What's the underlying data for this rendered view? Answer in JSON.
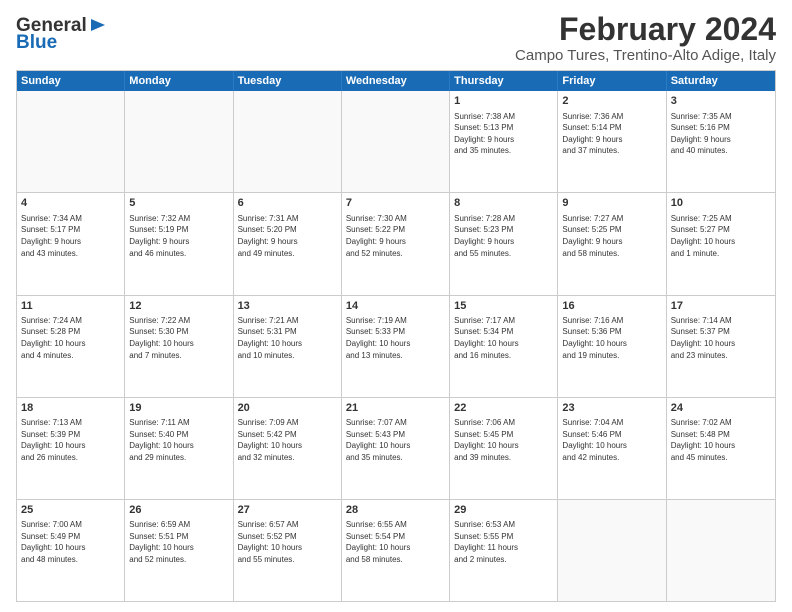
{
  "logo": {
    "line1": "General",
    "line2": "Blue",
    "arrow": true
  },
  "title": "February 2024",
  "subtitle": "Campo Tures, Trentino-Alto Adige, Italy",
  "days": [
    "Sunday",
    "Monday",
    "Tuesday",
    "Wednesday",
    "Thursday",
    "Friday",
    "Saturday"
  ],
  "weeks": [
    [
      {
        "day": "",
        "info": ""
      },
      {
        "day": "",
        "info": ""
      },
      {
        "day": "",
        "info": ""
      },
      {
        "day": "",
        "info": ""
      },
      {
        "day": "1",
        "info": "Sunrise: 7:38 AM\nSunset: 5:13 PM\nDaylight: 9 hours\nand 35 minutes."
      },
      {
        "day": "2",
        "info": "Sunrise: 7:36 AM\nSunset: 5:14 PM\nDaylight: 9 hours\nand 37 minutes."
      },
      {
        "day": "3",
        "info": "Sunrise: 7:35 AM\nSunset: 5:16 PM\nDaylight: 9 hours\nand 40 minutes."
      }
    ],
    [
      {
        "day": "4",
        "info": "Sunrise: 7:34 AM\nSunset: 5:17 PM\nDaylight: 9 hours\nand 43 minutes."
      },
      {
        "day": "5",
        "info": "Sunrise: 7:32 AM\nSunset: 5:19 PM\nDaylight: 9 hours\nand 46 minutes."
      },
      {
        "day": "6",
        "info": "Sunrise: 7:31 AM\nSunset: 5:20 PM\nDaylight: 9 hours\nand 49 minutes."
      },
      {
        "day": "7",
        "info": "Sunrise: 7:30 AM\nSunset: 5:22 PM\nDaylight: 9 hours\nand 52 minutes."
      },
      {
        "day": "8",
        "info": "Sunrise: 7:28 AM\nSunset: 5:23 PM\nDaylight: 9 hours\nand 55 minutes."
      },
      {
        "day": "9",
        "info": "Sunrise: 7:27 AM\nSunset: 5:25 PM\nDaylight: 9 hours\nand 58 minutes."
      },
      {
        "day": "10",
        "info": "Sunrise: 7:25 AM\nSunset: 5:27 PM\nDaylight: 10 hours\nand 1 minute."
      }
    ],
    [
      {
        "day": "11",
        "info": "Sunrise: 7:24 AM\nSunset: 5:28 PM\nDaylight: 10 hours\nand 4 minutes."
      },
      {
        "day": "12",
        "info": "Sunrise: 7:22 AM\nSunset: 5:30 PM\nDaylight: 10 hours\nand 7 minutes."
      },
      {
        "day": "13",
        "info": "Sunrise: 7:21 AM\nSunset: 5:31 PM\nDaylight: 10 hours\nand 10 minutes."
      },
      {
        "day": "14",
        "info": "Sunrise: 7:19 AM\nSunset: 5:33 PM\nDaylight: 10 hours\nand 13 minutes."
      },
      {
        "day": "15",
        "info": "Sunrise: 7:17 AM\nSunset: 5:34 PM\nDaylight: 10 hours\nand 16 minutes."
      },
      {
        "day": "16",
        "info": "Sunrise: 7:16 AM\nSunset: 5:36 PM\nDaylight: 10 hours\nand 19 minutes."
      },
      {
        "day": "17",
        "info": "Sunrise: 7:14 AM\nSunset: 5:37 PM\nDaylight: 10 hours\nand 23 minutes."
      }
    ],
    [
      {
        "day": "18",
        "info": "Sunrise: 7:13 AM\nSunset: 5:39 PM\nDaylight: 10 hours\nand 26 minutes."
      },
      {
        "day": "19",
        "info": "Sunrise: 7:11 AM\nSunset: 5:40 PM\nDaylight: 10 hours\nand 29 minutes."
      },
      {
        "day": "20",
        "info": "Sunrise: 7:09 AM\nSunset: 5:42 PM\nDaylight: 10 hours\nand 32 minutes."
      },
      {
        "day": "21",
        "info": "Sunrise: 7:07 AM\nSunset: 5:43 PM\nDaylight: 10 hours\nand 35 minutes."
      },
      {
        "day": "22",
        "info": "Sunrise: 7:06 AM\nSunset: 5:45 PM\nDaylight: 10 hours\nand 39 minutes."
      },
      {
        "day": "23",
        "info": "Sunrise: 7:04 AM\nSunset: 5:46 PM\nDaylight: 10 hours\nand 42 minutes."
      },
      {
        "day": "24",
        "info": "Sunrise: 7:02 AM\nSunset: 5:48 PM\nDaylight: 10 hours\nand 45 minutes."
      }
    ],
    [
      {
        "day": "25",
        "info": "Sunrise: 7:00 AM\nSunset: 5:49 PM\nDaylight: 10 hours\nand 48 minutes."
      },
      {
        "day": "26",
        "info": "Sunrise: 6:59 AM\nSunset: 5:51 PM\nDaylight: 10 hours\nand 52 minutes."
      },
      {
        "day": "27",
        "info": "Sunrise: 6:57 AM\nSunset: 5:52 PM\nDaylight: 10 hours\nand 55 minutes."
      },
      {
        "day": "28",
        "info": "Sunrise: 6:55 AM\nSunset: 5:54 PM\nDaylight: 10 hours\nand 58 minutes."
      },
      {
        "day": "29",
        "info": "Sunrise: 6:53 AM\nSunset: 5:55 PM\nDaylight: 11 hours\nand 2 minutes."
      },
      {
        "day": "",
        "info": ""
      },
      {
        "day": "",
        "info": ""
      }
    ]
  ]
}
